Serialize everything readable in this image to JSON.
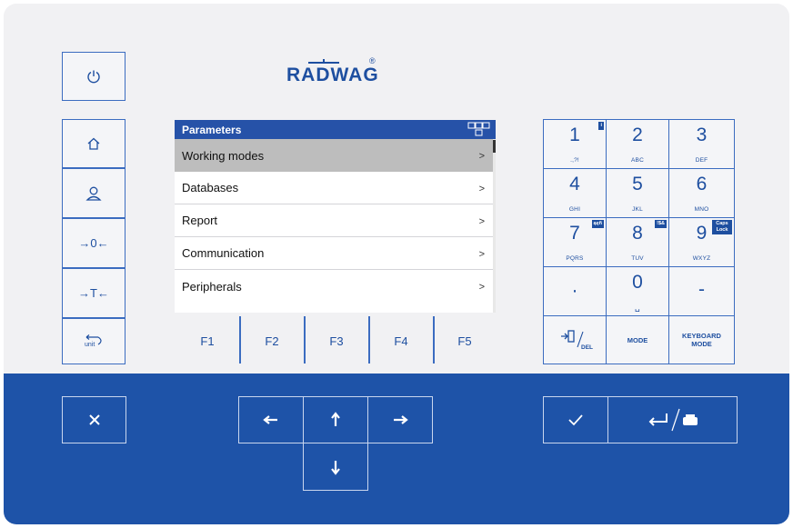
{
  "brand": {
    "logo_text": "RADWAG",
    "registered": "®"
  },
  "screen": {
    "title": "Parameters",
    "items": [
      {
        "label": "Working modes",
        "chevron": ">"
      },
      {
        "label": "Databases",
        "chevron": ">"
      },
      {
        "label": "Report",
        "chevron": ">"
      },
      {
        "label": "Communication",
        "chevron": ">"
      },
      {
        "label": "Peripherals",
        "chevron": ">"
      }
    ]
  },
  "function_keys": [
    "F1",
    "F2",
    "F3",
    "F4",
    "F5"
  ],
  "left_keys": {
    "power_icon": "power-icon",
    "home_icon": "home-icon",
    "user_icon": "user-icon",
    "zero_label": "→0←",
    "tare_label": "→T←",
    "unit_label": "unit"
  },
  "keypad": [
    {
      "digit": "1",
      "letters": ".,?!",
      "badge": "i"
    },
    {
      "digit": "2",
      "letters": "ABC"
    },
    {
      "digit": "3",
      "letters": "DEF"
    },
    {
      "digit": "4",
      "letters": "GHI"
    },
    {
      "digit": "5",
      "letters": "JKL"
    },
    {
      "digit": "6",
      "letters": "MNO"
    },
    {
      "digit": "7",
      "letters": "PQRS",
      "badge": "ąęñ"
    },
    {
      "digit": "8",
      "letters": "TUV",
      "badge": "!$&"
    },
    {
      "digit": "9",
      "letters": "WXYZ",
      "badge": "Caps Lock"
    },
    {
      "digit": "·",
      "letters": ""
    },
    {
      "digit": "0",
      "letters": "␣"
    },
    {
      "digit": "-",
      "letters": ""
    }
  ],
  "keypad_bottom": {
    "del_label": "DEL",
    "mode_label": "MODE",
    "keyboard_mode_label": "KEYBOARD MODE"
  },
  "nav_icons": [
    "close-icon",
    "arrow-left-icon",
    "arrow-up-icon",
    "arrow-right-icon",
    "arrow-down-icon",
    "check-icon",
    "enter-print-icon"
  ]
}
